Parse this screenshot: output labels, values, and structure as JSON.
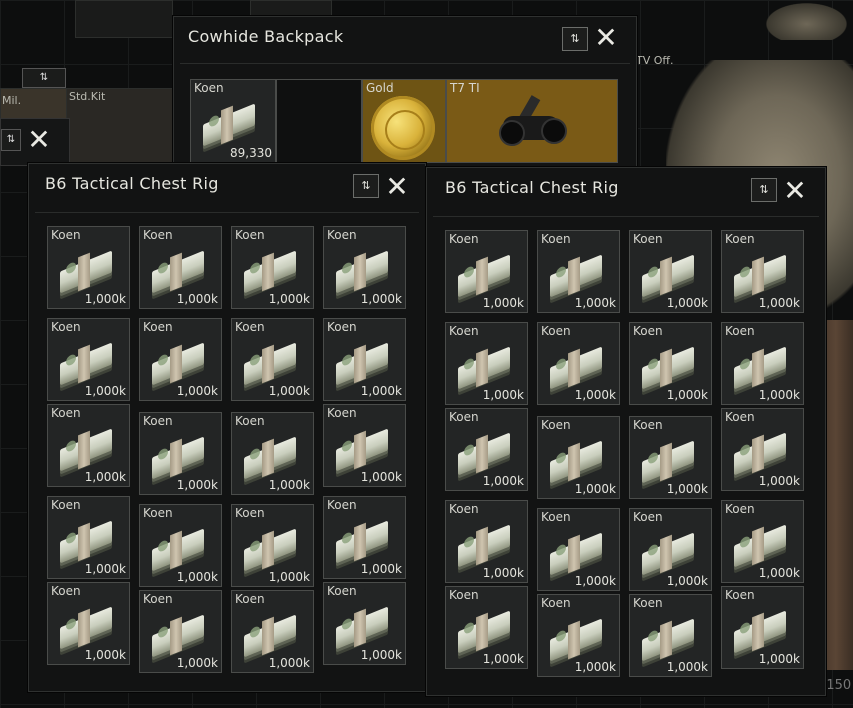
{
  "background": {
    "labels": [
      "Mil.",
      "Std.Kit",
      "TV Off."
    ],
    "sort_symbol": "⇅",
    "counter_text": "/150"
  },
  "backpack": {
    "title": "Cowhide Backpack",
    "items": [
      {
        "name": "Koen",
        "count": "89,330"
      },
      {
        "name": "Gold",
        "count": ""
      },
      {
        "name": "T7 TI",
        "count": ""
      }
    ]
  },
  "rigs": [
    {
      "title": "B6 Tactical Chest Rig",
      "items": [
        {
          "name": "Koen",
          "count": "1,000k"
        },
        {
          "name": "Koen",
          "count": "1,000k"
        },
        {
          "name": "Koen",
          "count": "1,000k"
        },
        {
          "name": "Koen",
          "count": "1,000k"
        },
        {
          "name": "Koen",
          "count": "1,000k"
        },
        {
          "name": "Koen",
          "count": "1,000k"
        },
        {
          "name": "Koen",
          "count": "1,000k"
        },
        {
          "name": "Koen",
          "count": "1,000k"
        },
        {
          "name": "Koen",
          "count": "1,000k"
        },
        {
          "name": "Koen",
          "count": "1,000k"
        },
        {
          "name": "Koen",
          "count": "1,000k"
        },
        {
          "name": "Koen",
          "count": "1,000k"
        },
        {
          "name": "Koen",
          "count": "1,000k"
        },
        {
          "name": "Koen",
          "count": "1,000k"
        },
        {
          "name": "Koen",
          "count": "1,000k"
        },
        {
          "name": "Koen",
          "count": "1,000k"
        },
        {
          "name": "Koen",
          "count": "1,000k"
        },
        {
          "name": "Koen",
          "count": "1,000k"
        },
        {
          "name": "Koen",
          "count": "1,000k"
        },
        {
          "name": "Koen",
          "count": "1,000k"
        }
      ]
    },
    {
      "title": "B6 Tactical Chest Rig",
      "items": [
        {
          "name": "Koen",
          "count": "1,000k"
        },
        {
          "name": "Koen",
          "count": "1,000k"
        },
        {
          "name": "Koen",
          "count": "1,000k"
        },
        {
          "name": "Koen",
          "count": "1,000k"
        },
        {
          "name": "Koen",
          "count": "1,000k"
        },
        {
          "name": "Koen",
          "count": "1,000k"
        },
        {
          "name": "Koen",
          "count": "1,000k"
        },
        {
          "name": "Koen",
          "count": "1,000k"
        },
        {
          "name": "Koen",
          "count": "1,000k"
        },
        {
          "name": "Koen",
          "count": "1,000k"
        },
        {
          "name": "Koen",
          "count": "1,000k"
        },
        {
          "name": "Koen",
          "count": "1,000k"
        },
        {
          "name": "Koen",
          "count": "1,000k"
        },
        {
          "name": "Koen",
          "count": "1,000k"
        },
        {
          "name": "Koen",
          "count": "1,000k"
        },
        {
          "name": "Koen",
          "count": "1,000k"
        },
        {
          "name": "Koen",
          "count": "1,000k"
        },
        {
          "name": "Koen",
          "count": "1,000k"
        },
        {
          "name": "Koen",
          "count": "1,000k"
        },
        {
          "name": "Koen",
          "count": "1,000k"
        }
      ]
    }
  ],
  "icons": {
    "sort": "sort-icon",
    "close": "close-icon",
    "money": "koen-money-icon",
    "gold": "gold-coin-icon",
    "nvg": "thermal-goggles-icon"
  },
  "colors": {
    "window_bg": "#121313",
    "cell_bg": "#232525",
    "gold_cell_bg": "#6e5414",
    "nvg_cell_bg": "#7a5a16"
  }
}
